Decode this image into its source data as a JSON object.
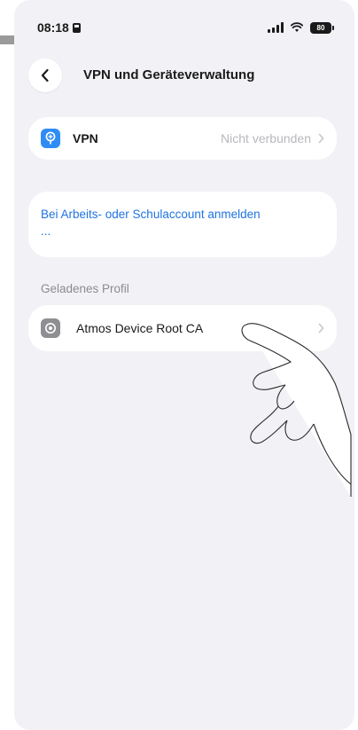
{
  "status_bar": {
    "time": "08:18",
    "battery": "80"
  },
  "nav": {
    "title": "VPN und Geräteverwaltung"
  },
  "vpn_row": {
    "label": "VPN",
    "status": "Nicht verbunden"
  },
  "account_row": {
    "link_text": "Bei Arbeits- oder Schulaccount anmelden ..."
  },
  "profiles": {
    "section_header": "Geladenes Profil",
    "items": [
      {
        "label": "Atmos Device Root CA"
      }
    ]
  },
  "colors": {
    "accent": "#1f74e0",
    "vpn_icon": "#2f8cf5",
    "secondary_text": "#b8b8bd"
  }
}
